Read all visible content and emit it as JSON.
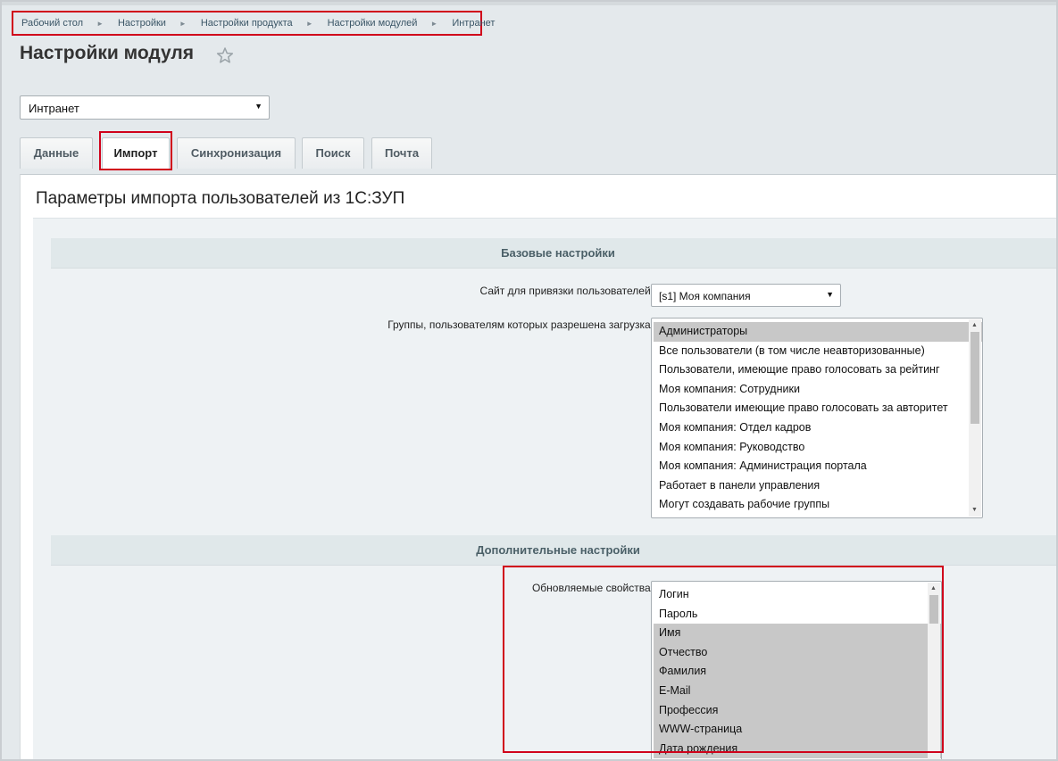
{
  "breadcrumb": [
    "Рабочий стол",
    "Настройки",
    "Настройки продукта",
    "Настройки модулей",
    "Интранет"
  ],
  "page": {
    "title": "Настройки модуля"
  },
  "module_select": {
    "value": "Интранет"
  },
  "tabs": [
    "Данные",
    "Импорт",
    "Синхронизация",
    "Поиск",
    "Почта"
  ],
  "active_tab": "Импорт",
  "panel": {
    "title": "Параметры импорта пользователей из 1С:ЗУП",
    "basic_section": "Базовые настройки",
    "site_label": "Сайт для привязки пользователей:",
    "site_value": "[s1] Моя компания",
    "groups_label": "Группы, пользователям которых разрешена загрузка:",
    "groups": [
      "Администраторы",
      "Все пользователи (в том числе неавторизованные)",
      "Пользователи, имеющие право голосовать за рейтинг",
      "Моя компания: Сотрудники",
      "Пользователи имеющие право голосовать за авторитет",
      "Моя компания: Отдел кадров",
      "Моя компания: Руководство",
      "Моя компания: Администрация портала",
      "Работает в панели управления",
      "Могут создавать рабочие группы"
    ],
    "groups_selected": [
      "Администраторы"
    ],
    "extra_section": "Дополнительные настройки",
    "props_label": "Обновляемые свойства:",
    "props": [
      "Логин",
      "Пароль",
      "Имя",
      "Отчество",
      "Фамилия",
      "E-Mail",
      "Профессия",
      "WWW-страница",
      "Дата рождения"
    ],
    "props_selected": [
      "Имя",
      "Отчество",
      "Фамилия",
      "E-Mail",
      "Профессия",
      "WWW-страница",
      "Дата рождения"
    ]
  },
  "colors": {
    "highlight": "#d0021b",
    "background": "#e4e9ec",
    "selection": "#c8c8c8"
  }
}
